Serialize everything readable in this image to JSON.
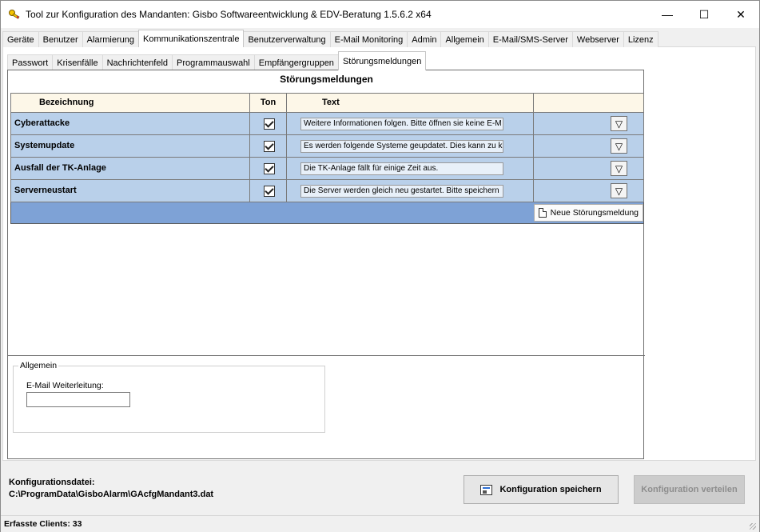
{
  "window": {
    "title": "Tool zur Konfiguration des Mandanten: Gisbo Softwareentwicklung & EDV-Beratung 1.5.6.2 x64",
    "minimize_glyph": "—",
    "maximize_glyph": "☐",
    "close_glyph": "✕",
    "app_icon": "key-icon"
  },
  "main_tabs": [
    "Geräte",
    "Benutzer",
    "Alarmierung",
    "Kommunikationszentrale",
    "Benutzerverwaltung",
    "E-Mail Monitoring",
    "Admin",
    "Allgemein",
    "E-Mail/SMS-Server",
    "Webserver",
    "Lizenz"
  ],
  "main_tab_active": "Kommunikationszentrale",
  "sub_tabs": [
    "Passwort",
    "Krisenfälle",
    "Nachrichtenfeld",
    "Programmauswahl",
    "Empfängergruppen",
    "Störungsmeldungen"
  ],
  "sub_tab_active": "Störungsmeldungen",
  "section_title": "Störungsmeldungen",
  "grid": {
    "headers": {
      "name": "Bezeichnung",
      "tone": "Ton",
      "text": "Text"
    },
    "rows": [
      {
        "name": "Cyberattacke",
        "tone": true,
        "text": "Weitere Informationen folgen. Bitte öffnen sie keine E-M"
      },
      {
        "name": "Systemupdate",
        "tone": true,
        "text": "Es werden folgende Systeme geupdatet. Dies kann zu k"
      },
      {
        "name": "Ausfall der TK-Anlage",
        "tone": true,
        "text": "Die TK-Anlage fällt für einige Zeit aus."
      },
      {
        "name": "Serverneustart",
        "tone": true,
        "text": "Die Server werden gleich neu gestartet. Bitte speichern"
      }
    ],
    "dropdown_glyph": "▽",
    "add_button_label": "Neue Störungsmeldung"
  },
  "general": {
    "legend": "Allgemein",
    "email_forward_label": "E-Mail Weiterleitung:",
    "email_forward_value": ""
  },
  "footer": {
    "config_file_label": "Konfigurationsdatei:",
    "config_file_path": "C:\\ProgramData\\GisboAlarm\\GAcfgMandant3.dat",
    "save_label": "Konfiguration speichern",
    "distribute_label": "Konfiguration verteilen"
  },
  "status": {
    "clients": "Erfasste Clients: 33"
  },
  "colors": {
    "row_bg": "#b9d0ea",
    "add_row_bg": "#7ea2d6",
    "header_bg": "#fdf7e8",
    "disabled_text": "#8d8d8d"
  }
}
